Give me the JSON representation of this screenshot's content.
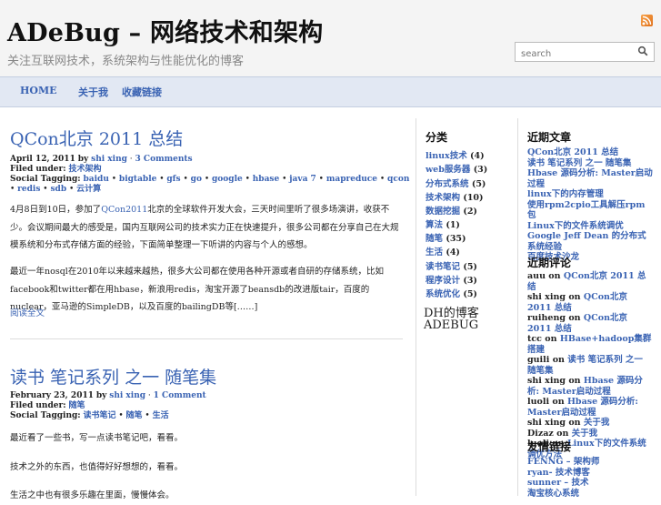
{
  "site": {
    "title": "ADeBug – 网络技术和架构",
    "tagline": "关注互联网技术，系统架构与性能优化的博客"
  },
  "search": {
    "placeholder": "search"
  },
  "nav": {
    "items": [
      "HOME",
      "关于我",
      "收藏链接"
    ]
  },
  "posts": [
    {
      "title": "QCon北京 2011 总结",
      "date": "April 12, 2011",
      "by": "by",
      "author": "shi xing",
      "comments": "3 Comments",
      "filed_label": "Filed under:",
      "filed": "技术架构",
      "social_label": "Social Tagging:",
      "tags": [
        "baidu",
        "bigtable",
        "gfs",
        "go",
        "google",
        "hbase",
        "java 7",
        "mapreduce",
        "qcon",
        "redis",
        "sdb",
        "云计算"
      ],
      "para1_prefix": "4月8日到10日，参加了",
      "para1_link": "QCon2011",
      "para1_rest": "北京的全球软件开发大会，三天时间里听了很多场演讲，收获不少。会议期间最大的感受是，国内互联网公司的技术实力正在快速提升，很多公司都在分享自己在大规模系统和分布式存储方面的经验，下面简单整理一下听讲的内容与个人的感想。",
      "para2": "最近一年nosql在2010年以来越来越热，很多大公司都在使用各种开源或者自研的存储系统，比如facebook和twitter都在用hbase，新浪用redis，淘宝开源了beansdb的改进版tair，百度的nuclear，亚马逊的SimpleDB，以及百度的bailingDB等[……]",
      "more": "阅读全文"
    },
    {
      "title": "读书 笔记系列 之一 随笔集",
      "date": "February 23, 2011",
      "by": "by",
      "author": "shi xing",
      "comments": "1 Comment",
      "filed_label": "Filed under:",
      "filed": "随笔",
      "social_label": "Social Tagging:",
      "tags": [
        "读书笔记",
        "随笔",
        "生活"
      ],
      "lines": [
        "最近看了一些书，写一点读书笔记吧，看看。",
        "技术之外的东西，也值得好好想想的，看看。",
        "生活之中也有很多乐趣在里面，慢慢体会。"
      ]
    }
  ],
  "sidebar": {
    "categories": {
      "heading": "分类",
      "items": [
        {
          "name": "linux技术",
          "count": "(4)"
        },
        {
          "name": "web服务器",
          "count": "(3)"
        },
        {
          "name": "分布式系统",
          "count": "(5)"
        },
        {
          "name": "技术架构",
          "count": "(10)"
        },
        {
          "name": "数据挖掘",
          "count": "(2)"
        },
        {
          "name": "算法",
          "count": "(1)"
        },
        {
          "name": "随笔",
          "count": "(35)"
        },
        {
          "name": "生活",
          "count": "(4)"
        },
        {
          "name": "读书笔记",
          "count": "(5)"
        },
        {
          "name": "程序设计",
          "count": "(3)"
        },
        {
          "name": "系统优化",
          "count": "(5)"
        }
      ]
    },
    "logo_line1": "DH的博客",
    "logo_line2": "ADEBUG",
    "recent_posts": {
      "heading": "近期文章",
      "items": [
        "QCon北京 2011 总结",
        "读书 笔记系列 之一 随笔集",
        "Hbase 源码分析: Master启动过程",
        "linux下的内存管理",
        "使用rpm2cpio工具解压rpm包",
        "Linux下的文件系统调优",
        "Google Jeff Dean 的分布式系统经验",
        "百度技术沙龙"
      ]
    },
    "recent_comments": {
      "heading": "近期评论",
      "items": [
        {
          "who": "auu",
          "on": "on",
          "what": "QCon北京 2011 总结"
        },
        {
          "who": "shi xing",
          "on": "on",
          "what": "QCon北京 2011 总结"
        },
        {
          "who": "ruiheng",
          "on": "on",
          "what": "QCon北京 2011 总结"
        },
        {
          "who": "tcc",
          "on": "on",
          "what": "HBase+hadoop集群搭建"
        },
        {
          "who": "guili",
          "on": "on",
          "what": "读书 笔记系列 之一 随笔集"
        },
        {
          "who": "shi xing",
          "on": "on",
          "what": "Hbase 源码分析: Master启动过程"
        },
        {
          "who": "luoli",
          "on": "on",
          "what": "Hbase 源码分析: Master启动过程"
        },
        {
          "who": "shi xing",
          "on": "on",
          "what": "关于我"
        },
        {
          "who": "Dizaz",
          "on": "on",
          "what": "关于我"
        },
        {
          "who": "luoli",
          "on": "on",
          "what": "Linux下的文件系统调优方法"
        }
      ]
    },
    "links": {
      "heading": "友情链接",
      "items": [
        "FENNG – 架构师",
        "ryan- 技术博客",
        "sunner – 技术",
        "淘宝核心系统"
      ]
    }
  }
}
